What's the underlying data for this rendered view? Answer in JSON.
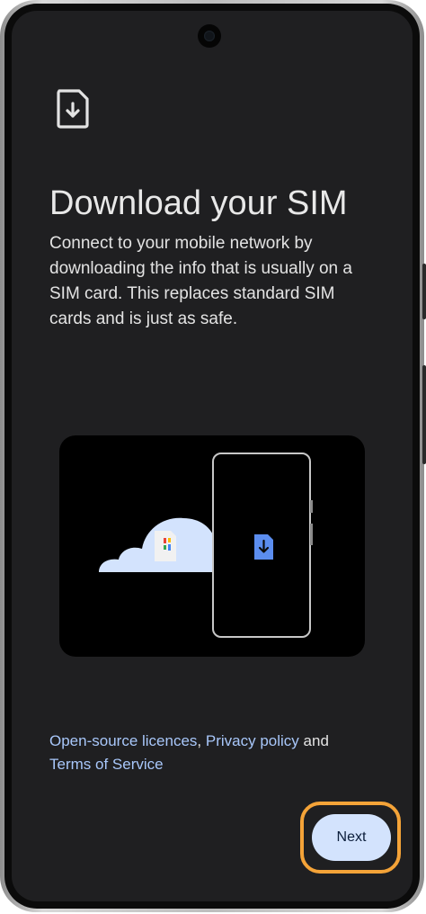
{
  "setup": {
    "title": "Download your SIM",
    "description": "Connect to your mobile network by downloading the info that is usually on a SIM card. This replaces standard SIM cards and is just as safe.",
    "icon": "sim-download-icon"
  },
  "footer": {
    "link_open_source": "Open-source licences",
    "separator": ",",
    "link_privacy": "Privacy policy",
    "and_text": "and",
    "link_terms": "Terms of Service",
    "next_label": "Next"
  },
  "colors": {
    "background": "#1f1f21",
    "link": "#a8c7fa",
    "button_bg": "#d3e3fd",
    "highlight": "#f4a338",
    "sim_blue": "#5b8def"
  }
}
